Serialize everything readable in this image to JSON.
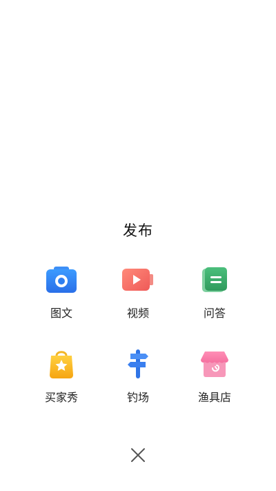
{
  "sheet": {
    "title": "发布",
    "items": [
      {
        "label": "图文",
        "icon": "camera-icon"
      },
      {
        "label": "视频",
        "icon": "video-play-icon"
      },
      {
        "label": "问答",
        "icon": "qa-note-icon"
      },
      {
        "label": "买家秀",
        "icon": "shopping-bag-star-icon"
      },
      {
        "label": "钓场",
        "icon": "signpost-icon"
      },
      {
        "label": "渔具店",
        "icon": "store-hook-icon"
      }
    ],
    "close_icon": "close-icon"
  },
  "colors": {
    "camera_blue": "#2f7ff0",
    "video_red": "#f2655f",
    "qa_green": "#33a464",
    "bag_yellow": "#f8b318",
    "signpost_blue": "#3b82f6",
    "store_pink": "#f47aa4"
  }
}
